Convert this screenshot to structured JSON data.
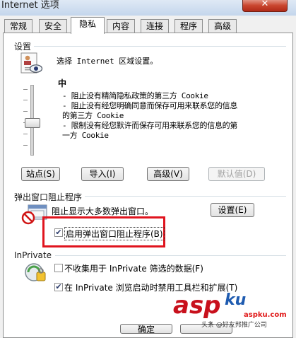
{
  "window": {
    "title": "Internet 选项",
    "close_glyph": "✕"
  },
  "tabs": [
    "常规",
    "安全",
    "隐私",
    "内容",
    "连接",
    "程序",
    "高级"
  ],
  "settings": {
    "group_label": "设置",
    "instruction": "选择 Internet 区域设置。",
    "level": "中",
    "desc_line1": "- 阻止没有精简隐私政策的第三方 Cookie",
    "desc_line2": "- 阻止没有经您明确同意而保存可用来联系您的信息",
    "desc_line3": "的第三方 Cookie",
    "desc_line4": "- 限制没有经您默许而保存可用来联系您的信息的第",
    "desc_line5": "一方 Cookie",
    "slider_level": "medium",
    "buttons": {
      "sites": "站点(S)",
      "import": "导入(I)",
      "advanced": "高级(V)",
      "default": "默认值(D)"
    }
  },
  "popup": {
    "group_label": "弹出窗口阻止程序",
    "desc": "阻止显示大多数弹出窗口。",
    "settings_button": "设置(E)",
    "enable_label": "启用弹出窗口阻止程序(B)",
    "enable_checked": true,
    "highlight_color": "#e0141e"
  },
  "inprivate": {
    "group_label": "InPrivate",
    "no_collect_label": "不收集用于 InPrivate 筛选的数据(F)",
    "no_collect_checked": false,
    "disable_toolbars_label": "在 InPrivate 浏览启动时禁用工具栏和扩展(T)",
    "disable_toolbars_checked": true
  },
  "footer": {
    "ok_label": "确定"
  },
  "watermark": {
    "brand": "asp",
    "domain": "aspku.com",
    "author": "头条 @好友邦推广公司"
  }
}
